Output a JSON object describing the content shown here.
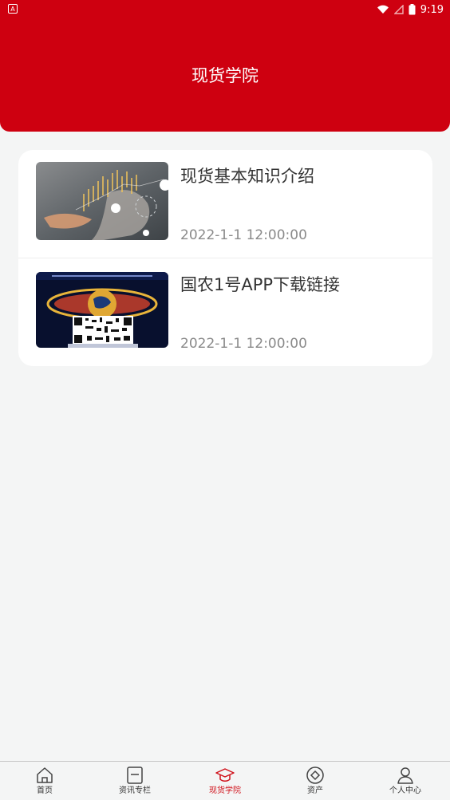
{
  "status_bar": {
    "left_icon": "A",
    "time": "9:19"
  },
  "header": {
    "title": "现货学院"
  },
  "articles": [
    {
      "title": "现货基本知识介绍",
      "date": "2022-1-1 12:00:00",
      "thumb": "hand-chart-image"
    },
    {
      "title": "国农1号APP下载链接",
      "date": "2022-1-1 12:00:00",
      "thumb": "app-qr-poster-image"
    }
  ],
  "tabbar": {
    "tabs": [
      {
        "label": "首页",
        "icon": "home-icon"
      },
      {
        "label": "资讯专栏",
        "icon": "news-icon"
      },
      {
        "label": "现货学院",
        "icon": "graduation-cap-icon",
        "active": true
      },
      {
        "label": "资产",
        "icon": "diamond-coin-icon"
      },
      {
        "label": "个人中心",
        "icon": "user-icon"
      }
    ]
  },
  "colors": {
    "brand": "#ce0010",
    "active_tab": "#d0121b",
    "background": "#f4f5f5"
  }
}
